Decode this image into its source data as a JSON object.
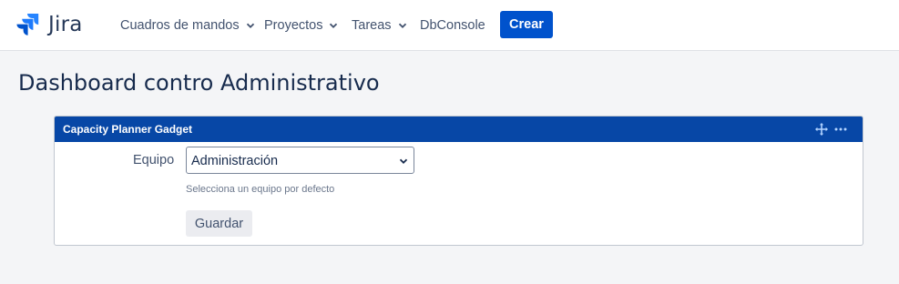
{
  "app": {
    "logo_icon": "jira-logo-icon",
    "logo_text": "Jira",
    "brand_color": "#0052cc"
  },
  "nav": {
    "items": [
      {
        "label": "Cuadros de mandos",
        "dropdown": true
      },
      {
        "label": "Proyectos",
        "dropdown": true
      },
      {
        "label": "Tareas",
        "dropdown": true
      },
      {
        "label": "DbConsole",
        "dropdown": false
      }
    ],
    "create_label": "Crear"
  },
  "page": {
    "title": "Dashboard contro Administrativo"
  },
  "gadget": {
    "title": "Capacity Planner Gadget",
    "header_color": "#0747a6",
    "move_icon": "move-icon",
    "more_icon": "more-icon",
    "team_label": "Equipo",
    "team_value": "Administración",
    "help_text": "Selecciona un equipo por defecto",
    "save_label": "Guardar"
  }
}
